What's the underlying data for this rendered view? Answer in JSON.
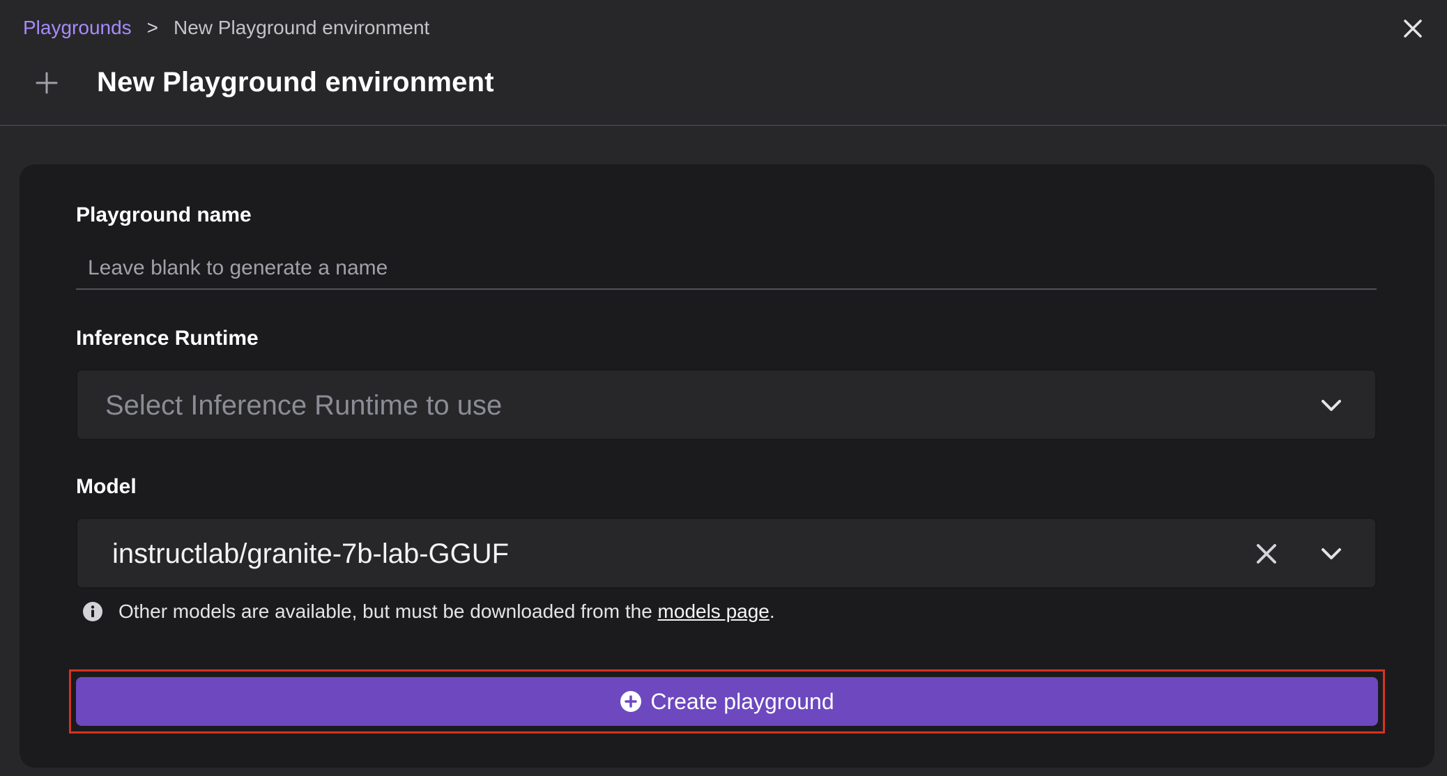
{
  "breadcrumb": {
    "parent": "Playgrounds",
    "separator": ">",
    "current": "New Playground environment"
  },
  "header": {
    "title": "New Playground environment",
    "icon": "plus-icon",
    "close_icon": "close-icon"
  },
  "form": {
    "name": {
      "label": "Playground name",
      "value": "",
      "placeholder": "Leave blank to generate a name"
    },
    "runtime": {
      "label": "Inference Runtime",
      "placeholder": "Select Inference Runtime to use",
      "icon": "chevron-down-icon"
    },
    "model": {
      "label": "Model",
      "value": "instructlab/granite-7b-lab-GGUF",
      "clear_icon": "clear-icon",
      "icon": "chevron-down-icon"
    },
    "helper": {
      "icon": "info-icon",
      "text_before": "Other models are available, but must be downloaded from the",
      "link_text": "models page",
      "text_after": "."
    },
    "submit": {
      "label": "Create playground",
      "icon": "plus-circle-icon"
    }
  },
  "colors": {
    "accent": "#6d48bf",
    "link": "#a78bfa",
    "highlight_border": "#d6331f",
    "background": "#27272a",
    "card": "#1b1b1d"
  }
}
